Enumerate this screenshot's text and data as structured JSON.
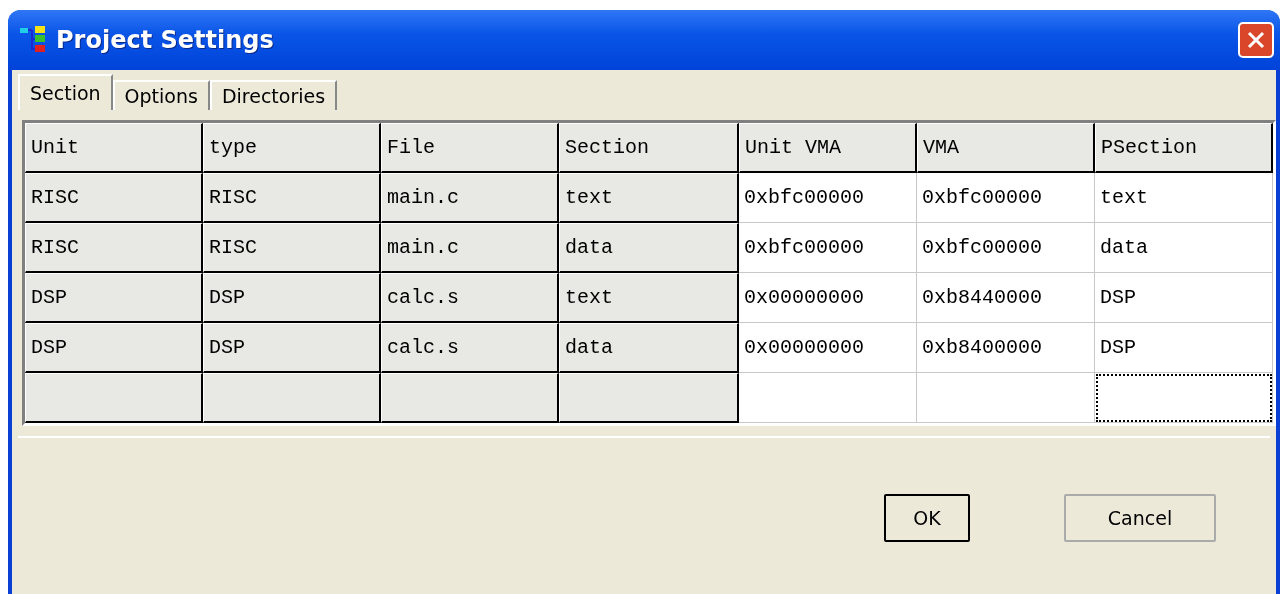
{
  "window": {
    "title": "Project Settings"
  },
  "tabs": [
    {
      "label": "Section",
      "selected": true
    },
    {
      "label": "Options",
      "selected": false
    },
    {
      "label": "Directories",
      "selected": false
    }
  ],
  "table": {
    "columns": [
      {
        "label": "Unit",
        "fixed": true
      },
      {
        "label": "type",
        "fixed": true
      },
      {
        "label": "File",
        "fixed": true
      },
      {
        "label": "Section",
        "fixed": true
      },
      {
        "label": "Unit VMA",
        "fixed": false
      },
      {
        "label": "VMA",
        "fixed": false
      },
      {
        "label": "PSection",
        "fixed": false
      }
    ],
    "rows": [
      {
        "cells": [
          "RISC",
          "RISC",
          "main.c",
          "text",
          "0xbfc00000",
          "0xbfc00000",
          "text"
        ]
      },
      {
        "cells": [
          "RISC",
          "RISC",
          "main.c",
          "data",
          "0xbfc00000",
          "0xbfc00000",
          "data"
        ]
      },
      {
        "cells": [
          "DSP",
          "DSP",
          "calc.s",
          "text",
          "0x00000000",
          "0xb8440000",
          "DSP"
        ]
      },
      {
        "cells": [
          "DSP",
          "DSP",
          "calc.s",
          "data",
          "0x00000000",
          "0xb8400000",
          "DSP"
        ]
      }
    ],
    "new_row": {
      "focused": true
    }
  },
  "buttons": [
    {
      "label": "OK",
      "default": true
    },
    {
      "label": "Cancel",
      "default": false
    }
  ]
}
